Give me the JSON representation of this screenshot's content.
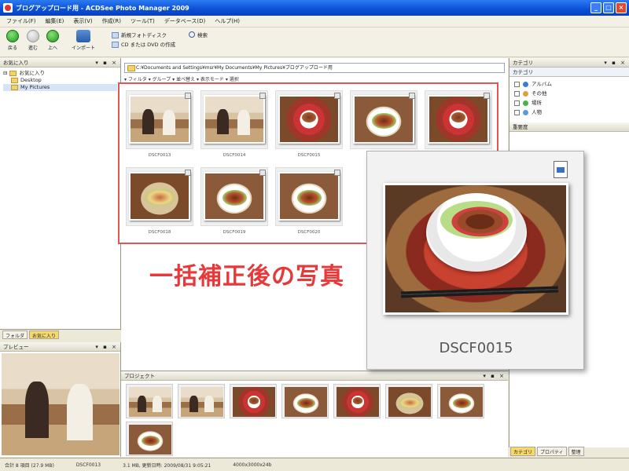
{
  "window": {
    "title": "ブログアップロード用 - ACDSee Photo Manager 2009"
  },
  "menu": [
    "ファイル(F)",
    "編集(E)",
    "表示(V)",
    "作成(R)",
    "ツール(T)",
    "データベース(D)",
    "ヘルプ(H)"
  ],
  "toolbar": {
    "back": "戻る",
    "forward": "進む",
    "up": "上へ",
    "import": "インポート",
    "new_disc": "新規フォトディスク",
    "cd_dvd": "CD または DVD の作成",
    "search": "検索"
  },
  "favorites": {
    "title": "お気に入り",
    "items": [
      "お気に入り",
      "Desktop",
      "My Pictures"
    ]
  },
  "left_tabs": [
    "フォルダ",
    "お気に入り"
  ],
  "preview": {
    "title": "プレビュー"
  },
  "path": "C:¥Documents and Settings¥msr¥My Documents¥My Pictures¥ブログアップロード用",
  "thumbnails": [
    {
      "caption": "DSCF0013",
      "kind": "people"
    },
    {
      "caption": "DSCF0014",
      "kind": "people"
    },
    {
      "caption": "DSCF0015",
      "kind": "bowl"
    },
    {
      "caption": "",
      "kind": "plate"
    },
    {
      "caption": "",
      "kind": "bowl"
    },
    {
      "caption": "DSCF0018",
      "kind": "tray"
    },
    {
      "caption": "DSCF0019",
      "kind": "plate"
    },
    {
      "caption": "DSCF0020",
      "kind": "plate"
    }
  ],
  "overlay_text": "一括補正後の写真",
  "popup": {
    "caption": "DSCF0015"
  },
  "category": {
    "title": "カテゴリ",
    "header": "カテゴリ",
    "items": [
      "アルバム",
      "その他",
      "場所",
      "人物"
    ],
    "rating_title": "重要度"
  },
  "right_tabs": [
    "カテゴリ",
    "プロパティ",
    "整理"
  ],
  "basket": {
    "title": "プロジェクト"
  },
  "status": {
    "total": "合計 8 項目 (27.9 MB)",
    "file": "DSCF0013",
    "info": "3.1 MB, 更新日時: 2009/08/31 9:05:21",
    "dims": "4000x3000x24b"
  },
  "colors": {
    "accent_red": "#e63a3a",
    "title_blue": "#0a4fd6"
  }
}
